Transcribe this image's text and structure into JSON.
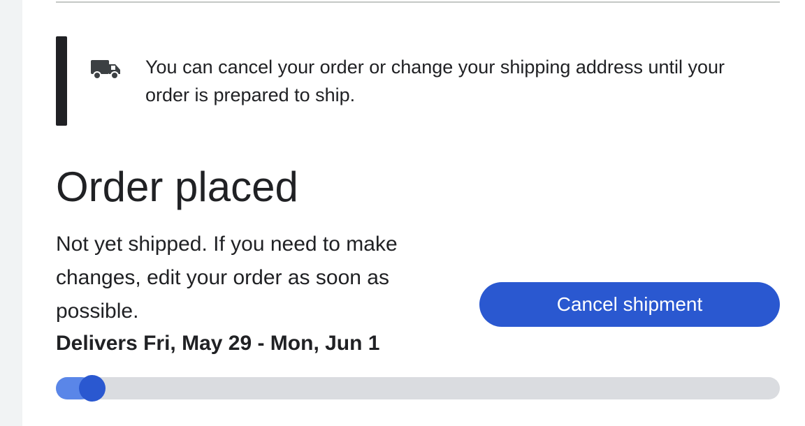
{
  "notice": {
    "icon": "truck-icon",
    "message": "You can cancel your order or change your shipping address until your order is prepared to ship."
  },
  "order": {
    "title": "Order placed",
    "status_message": "Not yet shipped. If you need to make changes, edit your order as soon as possible.",
    "delivery_estimate": "Delivers Fri, May 29 - Mon, Jun 1",
    "cancel_label": "Cancel shipment",
    "progress_fraction": 0.02
  },
  "colors": {
    "accent": "#2a58d0",
    "progress_track": "#dadce0",
    "notice_bar": "#202124"
  }
}
